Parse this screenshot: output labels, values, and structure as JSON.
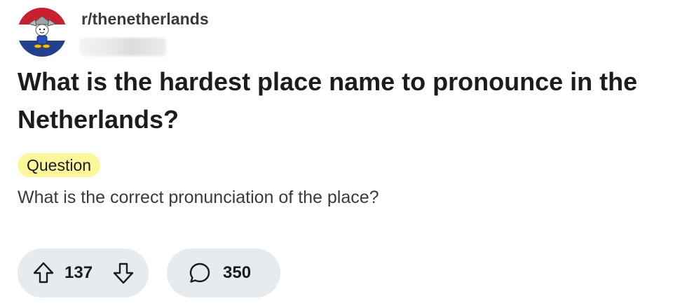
{
  "post": {
    "subreddit": "r/thenetherlands",
    "title": "What is the hardest place name to pronounce in the Netherlands?",
    "flair": "Question",
    "flair_color": "#fcf79b",
    "body": "What is the correct pronunciation of the place?",
    "upvotes": "137",
    "comments": "350"
  },
  "icons": {
    "avatar": "subreddit-avatar-dutch-flag",
    "upvote": "arrow-up-icon",
    "downvote": "arrow-down-icon",
    "comment": "speech-bubble-icon"
  },
  "colors": {
    "flag_red": "#c8202f",
    "flag_white": "#ffffff",
    "flag_blue": "#22408b",
    "pill_bg": "#e5ebee"
  }
}
